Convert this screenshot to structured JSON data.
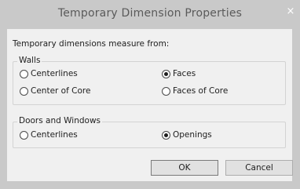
{
  "window": {
    "title": "Temporary Dimension Properties",
    "close_icon": "×"
  },
  "prompt": "Temporary dimensions measure from:",
  "walls": {
    "legend": "Walls",
    "options": [
      {
        "label": "Centerlines",
        "checked": false
      },
      {
        "label": "Faces",
        "checked": true
      },
      {
        "label": "Center of Core",
        "checked": false
      },
      {
        "label": "Faces of Core",
        "checked": false
      }
    ]
  },
  "doors_windows": {
    "legend": "Doors and Windows",
    "options": [
      {
        "label": "Centerlines",
        "checked": false
      },
      {
        "label": "Openings",
        "checked": true
      }
    ]
  },
  "buttons": {
    "ok": "OK",
    "cancel": "Cancel"
  }
}
